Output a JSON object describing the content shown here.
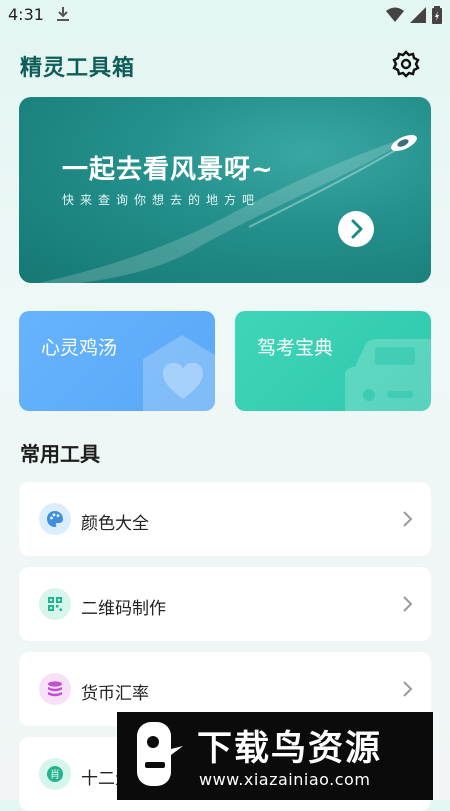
{
  "status": {
    "time": "4:31"
  },
  "header": {
    "title": "精灵工具箱"
  },
  "banner": {
    "title": "一起去看风景呀~",
    "subtitle": "快来查询你想去的地方吧"
  },
  "cards": [
    {
      "label": "心灵鸡汤",
      "color": "#5aa8f6"
    },
    {
      "label": "驾考宝典",
      "color": "#2fc8ad"
    }
  ],
  "section": {
    "title": "常用工具"
  },
  "tools": [
    {
      "label": "颜色大全",
      "icon": "palette-icon"
    },
    {
      "label": "二维码制作",
      "icon": "qrcode-icon"
    },
    {
      "label": "货币汇率",
      "icon": "coins-icon"
    },
    {
      "label": "十二生肖",
      "icon": "zodiac-icon"
    }
  ],
  "watermark": {
    "title": "下载鸟资源",
    "url": "www.xiazainiao.com"
  },
  "colors": {
    "accent": "#0f5d57",
    "banner": "#1f8a84"
  }
}
